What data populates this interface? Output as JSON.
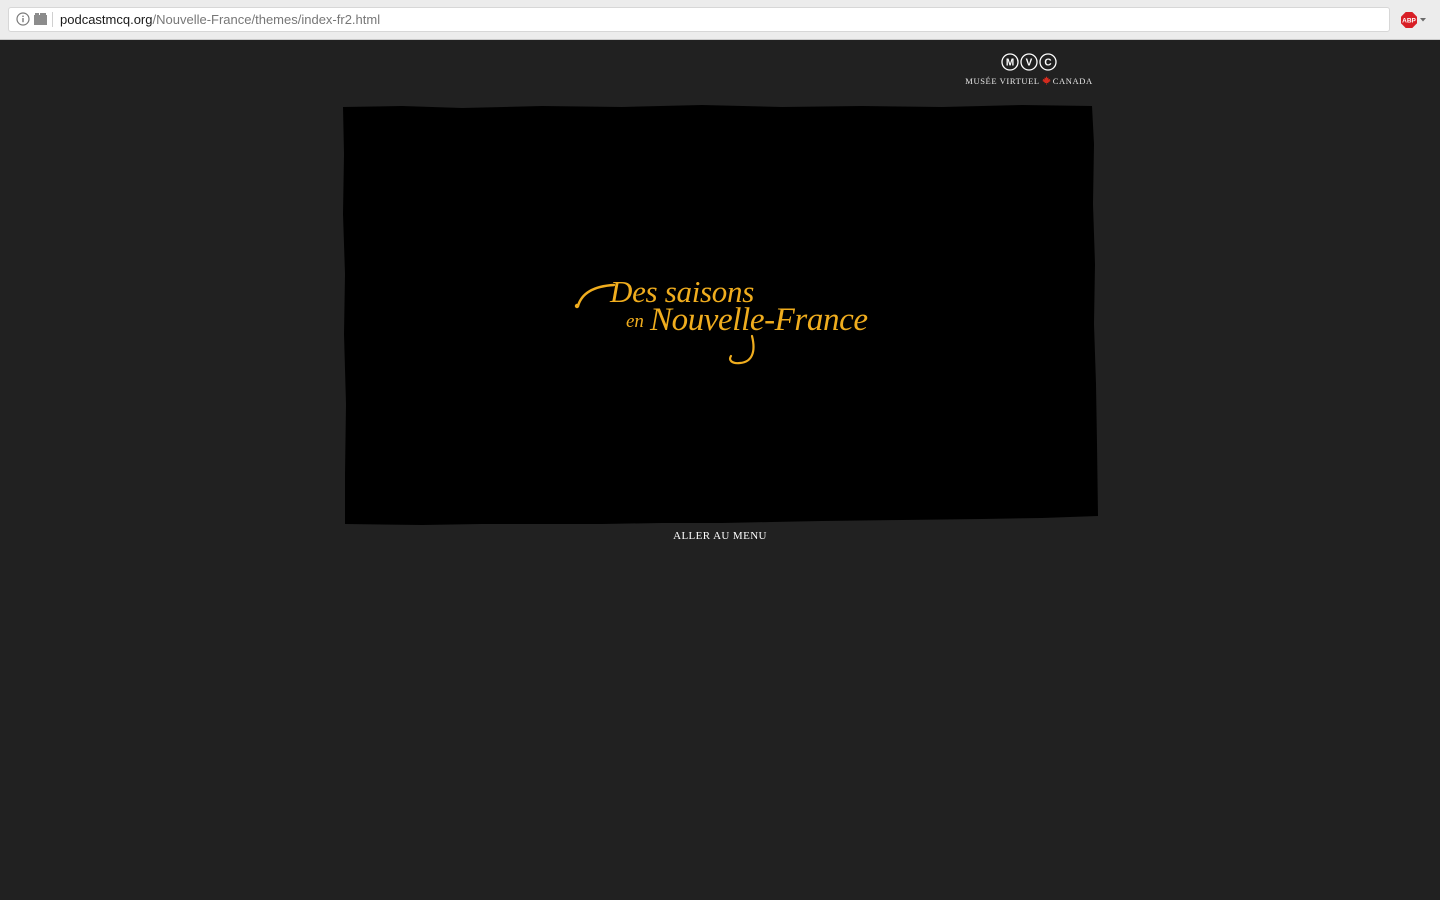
{
  "browser": {
    "url_host": "podcastmcq.org",
    "url_path": "/Nouvelle-France/themes/index-fr2.html",
    "info_icon": "info-icon",
    "page_icon": "page-icon",
    "extension_icon": "adblock-plus-icon",
    "extension_label": "ABP"
  },
  "logo": {
    "letters": [
      "M",
      "V",
      "C"
    ],
    "caption_left": "MUSÉE VIRTUEL",
    "caption_right": "CANADA",
    "maple_icon": "maple-leaf-icon",
    "maple_color": "#d52b1e"
  },
  "hero": {
    "title_line1": "Des saisons",
    "title_small": "en",
    "title_line2": "Nouvelle-France",
    "title_color": "#f0ad1e",
    "panel_color": "#000000"
  },
  "nav": {
    "menu_link": "ALLER AU MENU"
  },
  "colors": {
    "page_background": "#212121"
  }
}
